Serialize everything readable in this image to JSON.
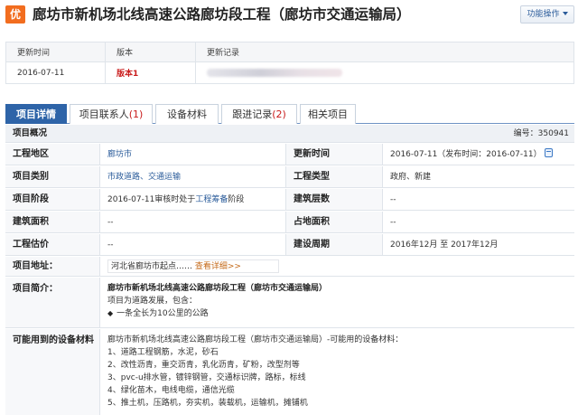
{
  "header": {
    "badge": "优",
    "title": "廊坊市新机场北线高速公路廊坊段工程（廊坊市交通运输局）",
    "func_button": "功能操作"
  },
  "versions": {
    "col_time": "更新时间",
    "col_version": "版本",
    "col_record": "更新记录",
    "row_time": "2016-07-11",
    "row_version": "版本1"
  },
  "tabs": [
    {
      "label": "项目详情",
      "count": ""
    },
    {
      "label": "项目联系人",
      "count": "(1)"
    },
    {
      "label": "设备材料",
      "count": ""
    },
    {
      "label": "跟进记录",
      "count": "(2)"
    },
    {
      "label": "相关项目",
      "count": ""
    }
  ],
  "overview": {
    "label": "项目概况",
    "number": "编号：350941"
  },
  "fields": {
    "region_label": "工程地区",
    "region_value": "廊坊市",
    "update_label": "更新时间",
    "update_value": "2016-07-11（发布时间：2016-07-11）",
    "category_label": "项目类别",
    "category_value": "市政道路、交通运输",
    "eng_type_label": "工程类型",
    "eng_type_value": "政府、新建",
    "stage_label": "项目阶段",
    "stage_prefix": "2016-07-11审核时处于",
    "stage_link": "工程筹备",
    "stage_suffix": "阶段",
    "floors_label": "建筑层数",
    "floors_value": "--",
    "area_label": "建筑面积",
    "area_value": "--",
    "land_label": "占地面积",
    "land_value": "--",
    "cost_label": "工程估价",
    "cost_value": "--",
    "period_label": "建设周期",
    "period_value": "2016年12月  至  2017年12月",
    "address_label": "项目地址：",
    "address_value": "河北省廊坊市起点……",
    "address_link": "查看详细>>",
    "intro_label": "项目简介：",
    "intro_title": "廊坊市新机场北线高速公路廊坊段工程（廊坊市交通运输局）",
    "intro_line1": "项目为道路发展，包含：",
    "intro_bullet": "◆",
    "intro_line2": "一条全长为10公里的公路",
    "equip_label": "可能用到的设备材料",
    "equip_line0": "廊坊市新机场北线高速公路廊坊段工程（廊坊市交通运输局）-可能用的设备材料：",
    "equip_line1": "1、道路工程钢筋，水泥，砂石",
    "equip_line2": "2、改性沥青，重交沥青，乳化沥青，矿粉，改型剂等",
    "equip_line3": "3、pvc-u排水管，镀锌钢管，交通标识牌，路标，标线",
    "equip_line4": "4、绿化苗木，电线电缆，通信光缆",
    "equip_line5": "5、推土机，压路机，夯实机，装载机，运输机，摊铺机"
  }
}
